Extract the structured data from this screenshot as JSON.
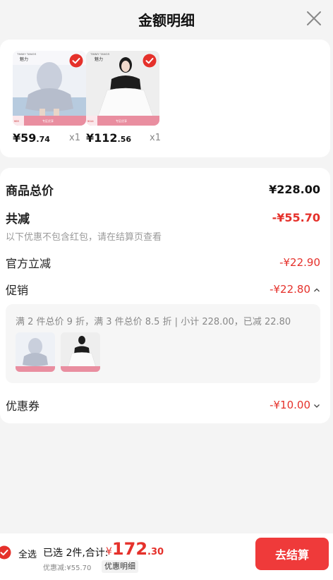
{
  "header": {
    "title": "金额明细"
  },
  "products": [
    {
      "brand": "TIMMY TANGS",
      "brand_cn": "魅力",
      "price_int": "¥59",
      "price_dec": ".74",
      "qty": "x1",
      "tag": "专区优享"
    },
    {
      "brand": "TIMMY TANGS",
      "brand_cn": "魅力",
      "price_int": "¥112",
      "price_dec": ".56",
      "qty": "x1",
      "tag": "专区优享"
    }
  ],
  "summary": {
    "goods_total_label": "商品总价",
    "goods_total_value": "¥228.00",
    "total_discount_label": "共减",
    "total_discount_value": "-¥55.70",
    "note": "以下优惠不包含红包，请在结算页查看",
    "official_label": "官方立减",
    "official_value": "-¥22.90",
    "promo_label": "促销",
    "promo_value": "-¥22.80",
    "promo_desc": "满 2 件总价 9 折，满 3 件总价 8.5 折 | 小计 228.00，已减 22.80",
    "coupon_label": "优惠券",
    "coupon_value": "-¥10.00"
  },
  "bottom": {
    "select_all": "全选",
    "selected_text": "已选 2件,合计:",
    "total_symbol": "¥",
    "total_int": "172",
    "total_dec": ".30",
    "saved_text": "优惠减:¥55.70",
    "detail_link": "优惠明细",
    "checkout": "去结算"
  },
  "colors": {
    "accent_red": "#e5312b",
    "checkout_bg": "#ef3a3a"
  }
}
